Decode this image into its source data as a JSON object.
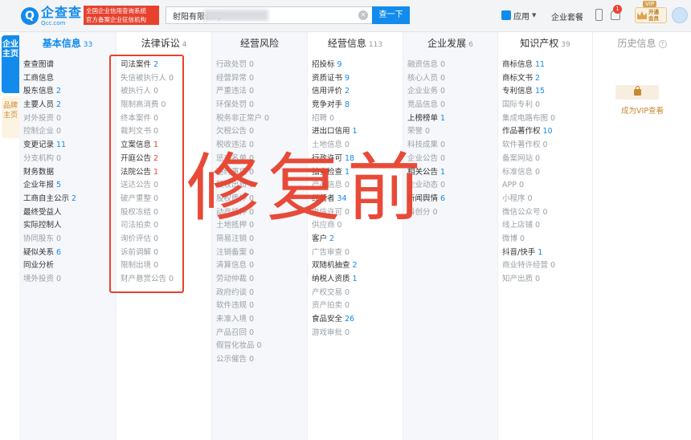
{
  "header": {
    "logo": {
      "mark": "Q",
      "name": "企查查",
      "domain": "Qcc.com"
    },
    "slogan": [
      "全国企业信用查询系统",
      "官方备案企业征信机构"
    ],
    "search": {
      "value": "射阳有限公司",
      "button": "查一下"
    },
    "app_menu": "应用",
    "enterprise_plan": "企业套餐",
    "notification_count": "1",
    "vip": {
      "label": "开通会员"
    }
  },
  "side_tabs": {
    "company": "企业主页",
    "brand": "品牌主页"
  },
  "columns": [
    {
      "title": "基本信息",
      "count": "33",
      "active": true,
      "items": [
        {
          "label": "查查图谱",
          "value": ""
        },
        {
          "label": "工商信息",
          "value": ""
        },
        {
          "label": "股东信息",
          "value": "2"
        },
        {
          "label": "主要人员",
          "value": "2"
        },
        {
          "label": "对外投资",
          "value": "0"
        },
        {
          "label": "控制企业",
          "value": "0"
        },
        {
          "label": "变更记录",
          "value": "11"
        },
        {
          "label": "分支机构",
          "value": "0"
        },
        {
          "label": "财务数据",
          "value": ""
        },
        {
          "label": "企业年报",
          "value": "5"
        },
        {
          "label": "工商自主公示",
          "value": "2"
        },
        {
          "label": "最终受益人",
          "value": ""
        },
        {
          "label": "实际控制人",
          "value": ""
        },
        {
          "label": "协同股东",
          "value": "0"
        },
        {
          "label": "疑似关系",
          "value": "6"
        },
        {
          "label": "同业分析",
          "value": ""
        },
        {
          "label": "境外投资",
          "value": "0"
        }
      ]
    },
    {
      "title": "法律诉讼",
      "count": "4",
      "active": false,
      "items": [
        {
          "label": "司法案件",
          "value": "2"
        },
        {
          "label": "失信被执行人",
          "value": "0"
        },
        {
          "label": "被执行人",
          "value": "0"
        },
        {
          "label": "限制高消费",
          "value": "0"
        },
        {
          "label": "终本案件",
          "value": "0"
        },
        {
          "label": "裁判文书",
          "value": "0"
        },
        {
          "label": "立案信息",
          "value": "1"
        },
        {
          "label": "开庭公告",
          "value": "2"
        },
        {
          "label": "法院公告",
          "value": "1"
        },
        {
          "label": "送达公告",
          "value": "0"
        },
        {
          "label": "破产重整",
          "value": "0"
        },
        {
          "label": "股权冻结",
          "value": "0"
        },
        {
          "label": "司法拍卖",
          "value": "0"
        },
        {
          "label": "询价评估",
          "value": "0"
        },
        {
          "label": "诉前调解",
          "value": "0"
        },
        {
          "label": "限制出境",
          "value": "0"
        },
        {
          "label": "财产悬赏公告",
          "value": "0"
        }
      ]
    },
    {
      "title": "经营风险",
      "count": "",
      "active": false,
      "items": [
        {
          "label": "行政处罚",
          "value": "0"
        },
        {
          "label": "经营异常",
          "value": "0"
        },
        {
          "label": "严重违法",
          "value": "0"
        },
        {
          "label": "环保处罚",
          "value": "0"
        },
        {
          "label": "税务非正常户",
          "value": "0"
        },
        {
          "label": "欠税公告",
          "value": "0"
        },
        {
          "label": "税收违法",
          "value": "0"
        },
        {
          "label": "惩戒名单",
          "value": "0"
        },
        {
          "label": "违约事项",
          "value": "0"
        },
        {
          "label": "股权出质",
          "value": "0"
        },
        {
          "label": "股权质押",
          "value": "0"
        },
        {
          "label": "动产抵押",
          "value": "0"
        },
        {
          "label": "土地抵押",
          "value": "0"
        },
        {
          "label": "简易注销",
          "value": "0"
        },
        {
          "label": "注销备案",
          "value": "0"
        },
        {
          "label": "清算信息",
          "value": "0"
        },
        {
          "label": "劳动仲裁",
          "value": "0"
        },
        {
          "label": "政府约谈",
          "value": "0"
        },
        {
          "label": "软件违规",
          "value": "0"
        },
        {
          "label": "未准入境",
          "value": "0"
        },
        {
          "label": "产品召回",
          "value": "0"
        },
        {
          "label": "假冒化妆品",
          "value": "0"
        },
        {
          "label": "公示催告",
          "value": "0"
        }
      ]
    },
    {
      "title": "经营信息",
      "count": "113",
      "active": false,
      "items": [
        {
          "label": "招投标",
          "value": "9"
        },
        {
          "label": "资质证书",
          "value": "9"
        },
        {
          "label": "信用评价",
          "value": "2"
        },
        {
          "label": "竞争对手",
          "value": "8"
        },
        {
          "label": "招聘",
          "value": "0"
        },
        {
          "label": "进出口信用",
          "value": "1"
        },
        {
          "label": "土地信息",
          "value": "0"
        },
        {
          "label": "行政许可",
          "value": "18"
        },
        {
          "label": "抽查检查",
          "value": "1"
        },
        {
          "label": "产品信息",
          "value": "0"
        },
        {
          "label": "经营者",
          "value": "34"
        },
        {
          "label": "电信许可",
          "value": "0"
        },
        {
          "label": "供应商",
          "value": "0"
        },
        {
          "label": "客户",
          "value": "2"
        },
        {
          "label": "广告审查",
          "value": "0"
        },
        {
          "label": "双随机抽查",
          "value": "2"
        },
        {
          "label": "纳税人资质",
          "value": "1"
        },
        {
          "label": "产权交易",
          "value": "0"
        },
        {
          "label": "资产拍卖",
          "value": "0"
        },
        {
          "label": "食品安全",
          "value": "26"
        },
        {
          "label": "游戏审批",
          "value": "0"
        }
      ]
    },
    {
      "title": "企业发展",
      "count": "6",
      "active": false,
      "items": [
        {
          "label": "融资信息",
          "value": "0"
        },
        {
          "label": "核心人员",
          "value": "0"
        },
        {
          "label": "企业业务",
          "value": "0"
        },
        {
          "label": "竞品信息",
          "value": "0"
        },
        {
          "label": "上榜榜单",
          "value": "1"
        },
        {
          "label": "荣誉",
          "value": "0"
        },
        {
          "label": "科技成果",
          "value": "0"
        },
        {
          "label": "企业公告",
          "value": "0"
        },
        {
          "label": "相关公告",
          "value": "1"
        },
        {
          "label": "企业动态",
          "value": "0"
        },
        {
          "label": "新闻舆情",
          "value": "6"
        },
        {
          "label": "科创分",
          "value": "0"
        }
      ]
    },
    {
      "title": "知识产权",
      "count": "39",
      "active": false,
      "items": [
        {
          "label": "商标信息",
          "value": "11"
        },
        {
          "label": "商标文书",
          "value": "2"
        },
        {
          "label": "专利信息",
          "value": "15"
        },
        {
          "label": "国际专利",
          "value": "0"
        },
        {
          "label": "集成电路布图",
          "value": "0"
        },
        {
          "label": "作品著作权",
          "value": "10"
        },
        {
          "label": "软件著作权",
          "value": "0"
        },
        {
          "label": "备案网站",
          "value": "0"
        },
        {
          "label": "标准信息",
          "value": "0"
        },
        {
          "label": "APP",
          "value": "0"
        },
        {
          "label": "小程序",
          "value": "0"
        },
        {
          "label": "微信公众号",
          "value": "0"
        },
        {
          "label": "线上店铺",
          "value": "0"
        },
        {
          "label": "微博",
          "value": "0"
        },
        {
          "label": "抖音/快手",
          "value": "1"
        },
        {
          "label": "商业特许经营",
          "value": "0"
        },
        {
          "label": "知产出质",
          "value": "0"
        }
      ]
    },
    {
      "title": "历史信息",
      "count": "",
      "active": false,
      "vip_tag": "VIP",
      "help": "?",
      "unlock": "成为VIP查看",
      "items": []
    }
  ],
  "overlay_text": "修复前",
  "colors": {
    "brand": "#128bed",
    "red": "#e8412e",
    "gold": "#c9882d"
  }
}
